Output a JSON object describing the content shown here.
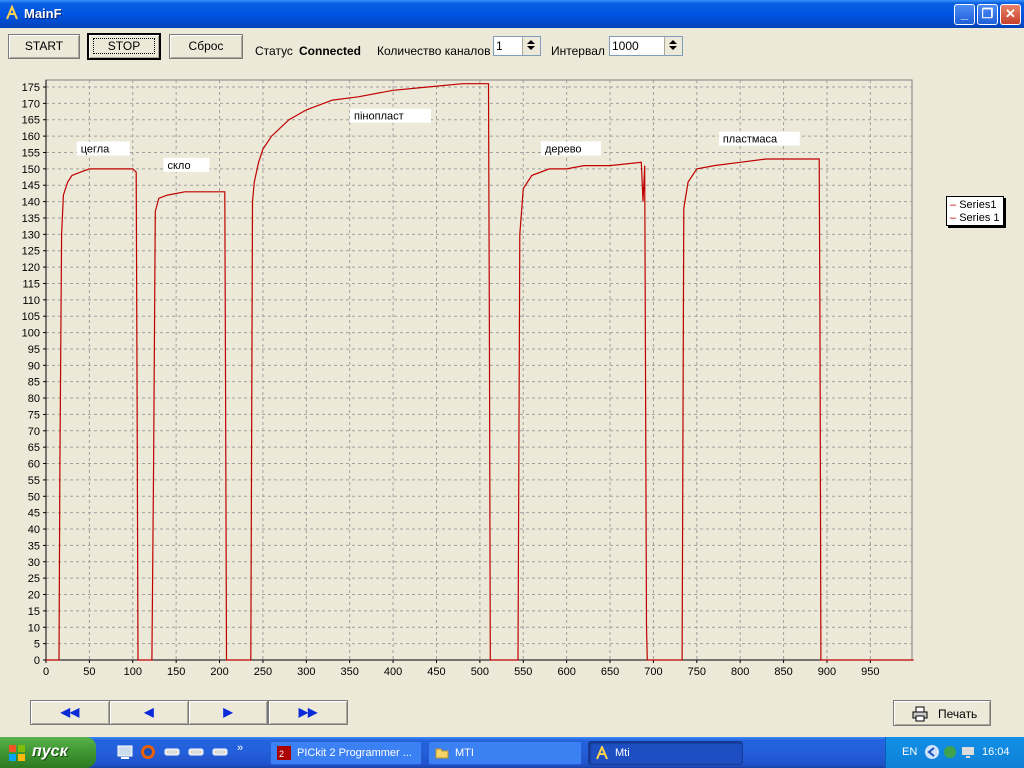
{
  "window": {
    "title": "MainF"
  },
  "toolbar": {
    "start_label": "START",
    "stop_label": "STOP",
    "reset_label": "Сброс",
    "status_label": "Статус",
    "status_value": "Connected",
    "channels_label": "Количество каналов",
    "channels_value": "1",
    "interval_label": "Интервал",
    "interval_value": "1000"
  },
  "chart_data": {
    "type": "line",
    "xlim": [
      0,
      1000
    ],
    "ylim": [
      0,
      175
    ],
    "x_ticks": [
      0,
      50,
      100,
      150,
      200,
      250,
      300,
      350,
      400,
      450,
      500,
      550,
      600,
      650,
      700,
      750,
      800,
      850,
      900,
      950
    ],
    "y_ticks": [
      0,
      5,
      10,
      15,
      20,
      25,
      30,
      35,
      40,
      45,
      50,
      55,
      60,
      65,
      70,
      75,
      80,
      85,
      90,
      95,
      100,
      105,
      110,
      115,
      120,
      125,
      130,
      135,
      140,
      145,
      150,
      155,
      160,
      165,
      170,
      175
    ],
    "grid": true,
    "legend_placement": "right",
    "series": [
      {
        "name": "Series1",
        "color": "#c00000",
        "points": [
          [
            0,
            0
          ],
          [
            15,
            0
          ],
          [
            16,
            60
          ],
          [
            18,
            130
          ],
          [
            20,
            142
          ],
          [
            25,
            146
          ],
          [
            30,
            148
          ],
          [
            40,
            149
          ],
          [
            50,
            150
          ],
          [
            60,
            150
          ],
          [
            80,
            150
          ],
          [
            100,
            150
          ],
          [
            104,
            149
          ],
          [
            105,
            80
          ],
          [
            106,
            0
          ],
          [
            122,
            0
          ],
          [
            124,
            60
          ],
          [
            126,
            137
          ],
          [
            130,
            141
          ],
          [
            140,
            142
          ],
          [
            160,
            143
          ],
          [
            180,
            143
          ],
          [
            200,
            143
          ],
          [
            206,
            143
          ],
          [
            207,
            80
          ],
          [
            208,
            0
          ],
          [
            236,
            0
          ],
          [
            238,
            140
          ],
          [
            240,
            146
          ],
          [
            245,
            152
          ],
          [
            250,
            156
          ],
          [
            260,
            160
          ],
          [
            280,
            165
          ],
          [
            300,
            168
          ],
          [
            330,
            171
          ],
          [
            360,
            172
          ],
          [
            400,
            174
          ],
          [
            440,
            175
          ],
          [
            480,
            176
          ],
          [
            510,
            176
          ],
          [
            511,
            100
          ],
          [
            512,
            0
          ],
          [
            544,
            0
          ],
          [
            546,
            130
          ],
          [
            550,
            144
          ],
          [
            560,
            148
          ],
          [
            580,
            150
          ],
          [
            600,
            150
          ],
          [
            620,
            151
          ],
          [
            650,
            151
          ],
          [
            686,
            152
          ],
          [
            688,
            140
          ],
          [
            690,
            151
          ],
          [
            692,
            10
          ],
          [
            693,
            0
          ],
          [
            733,
            0
          ],
          [
            735,
            138
          ],
          [
            740,
            146
          ],
          [
            750,
            150
          ],
          [
            770,
            151
          ],
          [
            800,
            152
          ],
          [
            830,
            153
          ],
          [
            860,
            153
          ],
          [
            891,
            153
          ],
          [
            892,
            100
          ],
          [
            893,
            0
          ],
          [
            930,
            0
          ],
          [
            1000,
            0
          ]
        ]
      },
      {
        "name": "Series 1",
        "color": "#c00000",
        "points": []
      }
    ],
    "annotations": [
      {
        "text": "цегла",
        "x": 40,
        "y": 155
      },
      {
        "text": "скло",
        "x": 140,
        "y": 150
      },
      {
        "text": "пінопласт",
        "x": 355,
        "y": 165
      },
      {
        "text": "дерево",
        "x": 575,
        "y": 155
      },
      {
        "text": "пластмаса",
        "x": 780,
        "y": 158
      }
    ]
  },
  "legend": {
    "items": [
      "Series1",
      "Series 1"
    ]
  },
  "nav": {
    "first": "◀◀",
    "prev": "◀",
    "next": "▶",
    "last": "▶▶"
  },
  "print": {
    "label": "Печать"
  },
  "taskbar": {
    "start": "пуск",
    "tasks": [
      {
        "label": "PICkit 2 Programmer ...",
        "active": false
      },
      {
        "label": "MTI",
        "active": false
      },
      {
        "label": "Mti",
        "active": true
      }
    ],
    "lang": "EN",
    "clock": "16:04"
  },
  "colors": {
    "series": "#c00000",
    "titlebar": "#0054e3",
    "taskbar": "#245edb"
  }
}
